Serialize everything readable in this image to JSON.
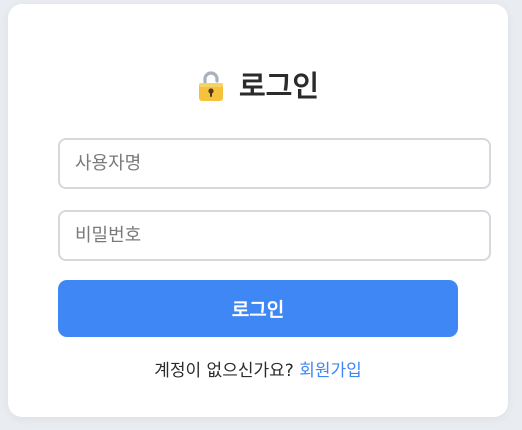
{
  "login": {
    "title": "로그인",
    "icon": "lock-icon",
    "username": {
      "value": "",
      "placeholder": "사용자명"
    },
    "password": {
      "value": "",
      "placeholder": "비밀번호"
    },
    "submit_label": "로그인",
    "signup_prompt": "계정이 없으신가요? ",
    "signup_link": "회원가입"
  },
  "colors": {
    "accent": "#3f87f5",
    "background": "#e9ecf1",
    "card": "#ffffff",
    "input_border": "#d5d8dd",
    "text": "#2b2b2b"
  }
}
